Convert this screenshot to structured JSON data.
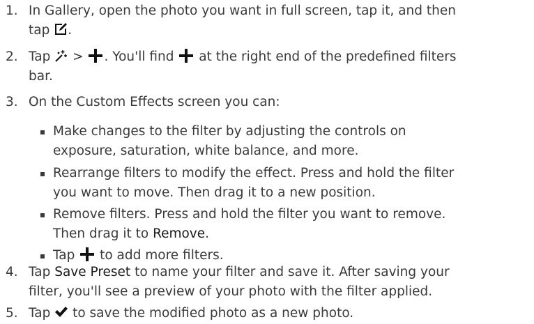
{
  "steps": [
    {
      "num": "1.",
      "text_a": "In Gallery, open the photo you want in full screen, tap it, and then",
      "text_b": "tap ",
      "text_c": "."
    },
    {
      "num": "2.",
      "text_a": "Tap ",
      "text_b": " > ",
      "text_c": ". You'll find ",
      "text_d": " at the right end of the predefined filters",
      "text_e": "bar."
    },
    {
      "num": "3.",
      "text_a": "On the Custom Effects screen you can:"
    },
    {
      "num": "4.",
      "text_a": "Tap ",
      "bold": "Save Preset",
      "text_b": " to name your filter and save it. After saving your",
      "text_c": "filter, you'll see a preview of your photo with the filter applied."
    },
    {
      "num": "5.",
      "text_a": "Tap ",
      "text_b": " to save the modified photo as a new photo."
    }
  ],
  "bullets": [
    {
      "line1": "Make changes to the filter by adjusting the controls on",
      "line2": "exposure, saturation, white balance, and more."
    },
    {
      "line1": "Rearrange filters to modify the effect. Press and hold the filter",
      "line2": "you want to move. Then drag it to a new position."
    },
    {
      "line1": "Remove filters. Press and hold the filter you want to remove.",
      "line2a": "Then drag it to ",
      "bold": "Remove",
      "line2b": "."
    },
    {
      "line1a": "Tap ",
      "line1b": " to add more filters."
    }
  ],
  "icons": {
    "edit": "edit-icon",
    "effects": "magic-wand-icon",
    "add": "plus-icon",
    "done": "checkmark-icon"
  }
}
